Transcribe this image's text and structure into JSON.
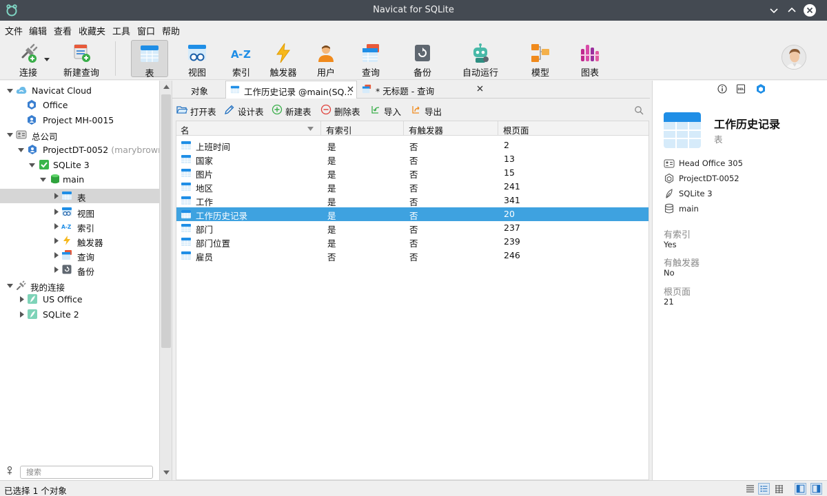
{
  "window": {
    "title": "Navicat for SQLite"
  },
  "menu": [
    "文件",
    "编辑",
    "查看",
    "收藏夹",
    "工具",
    "窗口",
    "帮助"
  ],
  "toolbar": {
    "connect": "连接",
    "new_query": "新建查询",
    "table": "表",
    "view": "视图",
    "index": "索引",
    "trigger": "触发器",
    "user": "用户",
    "query": "查询",
    "backup": "备份",
    "automation": "自动运行",
    "model": "模型",
    "chart": "图表"
  },
  "tree": {
    "items": [
      {
        "label": "Navicat Cloud"
      },
      {
        "label": "Office"
      },
      {
        "label": "Project MH-0015"
      },
      {
        "label": "总公司"
      },
      {
        "label": "ProjectDT-0052",
        "sub": "(marybrown@"
      },
      {
        "label": "SQLite 3"
      },
      {
        "label": "main"
      },
      {
        "label": "表"
      },
      {
        "label": "视图"
      },
      {
        "label": "索引"
      },
      {
        "label": "触发器"
      },
      {
        "label": "查询"
      },
      {
        "label": "备份"
      },
      {
        "label": "我的连接"
      },
      {
        "label": "US Office"
      },
      {
        "label": "SQLite 2"
      }
    ],
    "search_placeholder": "搜索"
  },
  "tabs": {
    "objects": "对象",
    "tab1": "工作历史记录 @main(SQ...",
    "tab2": "* 无标题 - 查询"
  },
  "objtoolbar": {
    "open": "打开表",
    "design": "设计表",
    "new": "新建表",
    "delete": "删除表",
    "import": "导入",
    "export": "导出"
  },
  "grid": {
    "columns": [
      "名",
      "有索引",
      "有触发器",
      "根页面"
    ],
    "rows": [
      [
        "上班时间",
        "是",
        "否",
        "2"
      ],
      [
        "国家",
        "是",
        "否",
        "13"
      ],
      [
        "图片",
        "是",
        "否",
        "15"
      ],
      [
        "地区",
        "是",
        "否",
        "241"
      ],
      [
        "工作",
        "是",
        "否",
        "341"
      ],
      [
        "工作历史记录",
        "是",
        "否",
        "20"
      ],
      [
        "部门",
        "是",
        "否",
        "237"
      ],
      [
        "部门位置",
        "是",
        "否",
        "239"
      ],
      [
        "雇员",
        "否",
        "否",
        "246"
      ]
    ],
    "selected_row": 5
  },
  "details": {
    "title": "工作历史记录",
    "subtitle": "表",
    "connection": "Head Office 305",
    "project": "ProjectDT-0052",
    "database": "SQLite 3",
    "schema": "main",
    "props": [
      {
        "name": "有索引",
        "value": "Yes"
      },
      {
        "name": "有触发器",
        "value": "No"
      },
      {
        "name": "根页面",
        "value": "21"
      }
    ]
  },
  "status": {
    "text": "已选择 1 个对象"
  },
  "colors": {
    "accent": "#3ea2e0",
    "titlebar": "#444a52"
  }
}
